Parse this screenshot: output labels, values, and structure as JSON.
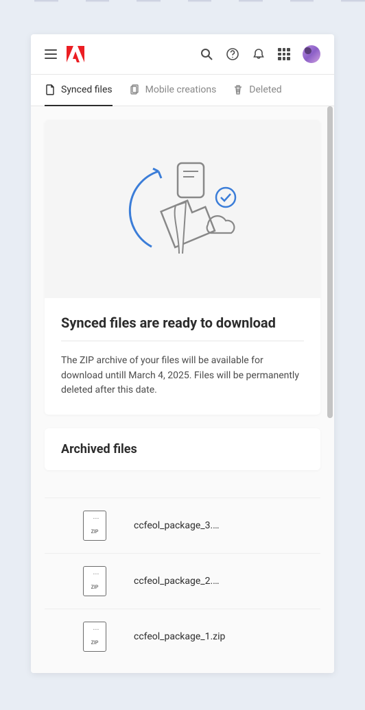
{
  "tabs": [
    {
      "label": "Synced files",
      "active": true
    },
    {
      "label": "Mobile creations",
      "active": false
    },
    {
      "label": "Deleted",
      "active": false
    }
  ],
  "hero": {
    "title": "Synced files are ready to download",
    "description": "The ZIP archive of your files will be available for download untill March 4, 2025. Files will be permanently deleted after this date."
  },
  "archived": {
    "title": "Archived files",
    "zip_label": "ZIP",
    "files": [
      {
        "name": "ccfeol_package_3.…"
      },
      {
        "name": "ccfeol_package_2.…"
      },
      {
        "name": "ccfeol_package_1.zip"
      }
    ]
  }
}
